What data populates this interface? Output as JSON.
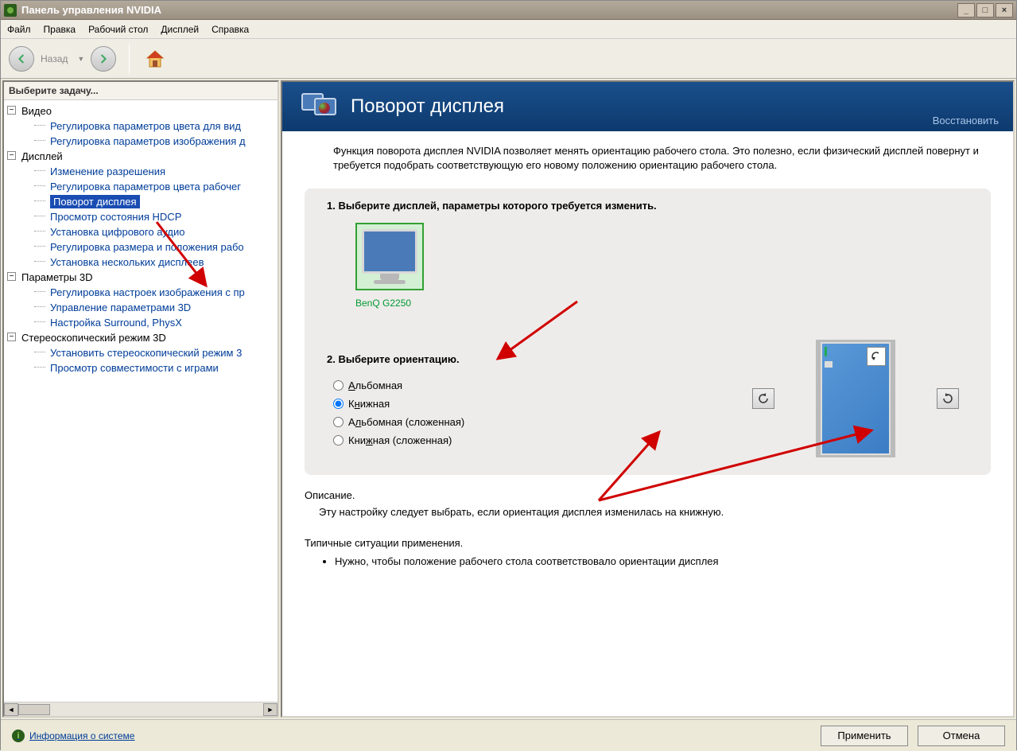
{
  "window": {
    "title": "Панель управления NVIDIA"
  },
  "menubar": {
    "items": [
      "Файл",
      "Правка",
      "Рабочий стол",
      "Дисплей",
      "Справка"
    ]
  },
  "toolbar": {
    "back_label": "Назад"
  },
  "sidebar": {
    "header": "Выберите задачу...",
    "groups": [
      {
        "label": "Видео",
        "items": [
          "Регулировка параметров цвета для вид",
          "Регулировка параметров изображения д"
        ]
      },
      {
        "label": "Дисплей",
        "items": [
          "Изменение разрешения",
          "Регулировка параметров цвета рабочег",
          "Поворот дисплея",
          "Просмотр состояния HDCP",
          "Установка цифрового аудио",
          "Регулировка размера и положения рабо",
          "Установка нескольких дисплеев"
        ]
      },
      {
        "label": "Параметры 3D",
        "items": [
          "Регулировка настроек изображения с пр",
          "Управление параметрами 3D",
          "Настройка Surround, PhysX"
        ]
      },
      {
        "label": "Стереоскопический режим 3D",
        "items": [
          "Установить стереоскопический режим 3",
          "Просмотр совместимости с играми"
        ]
      }
    ],
    "selected": "Поворот дисплея"
  },
  "content": {
    "title": "Поворот дисплея",
    "restore": "Восстановить",
    "intro": "Функция поворота дисплея NVIDIA позволяет менять ориентацию рабочего стола. Это полезно, если физический дисплей повернут и требуется подобрать соответствующую его новому положению ориентацию рабочего стола.",
    "step1": "1. Выберите дисплей, параметры которого требуется изменить.",
    "monitor_name": "BenQ G2250",
    "step2": "2. Выберите ориентацию.",
    "orientations": [
      "Альбомная",
      "Книжная",
      "Альбомная (сложенная)",
      "Книжная (сложенная)"
    ],
    "selected_orientation": 1,
    "description_label": "Описание.",
    "description_text": "Эту настройку следует выбрать, если ориентация дисплея изменилась на книжную.",
    "typical_label": "Типичные ситуации применения.",
    "typical_items": [
      "Нужно, чтобы положение рабочего стола соответствовало ориентации дисплея"
    ]
  },
  "footer": {
    "sys_info": "Информация о системе",
    "apply": "Применить",
    "cancel": "Отмена"
  }
}
